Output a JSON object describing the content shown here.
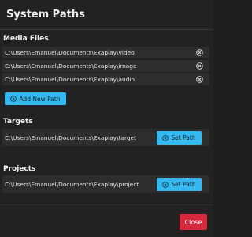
{
  "dialog": {
    "title": "System Paths"
  },
  "media_files": {
    "title": "Media Files",
    "paths": [
      "C:\\Users\\Emanuel\\Documents\\Exaplay\\video",
      "C:\\Users\\Emanuel\\Documents\\Exaplay\\image",
      "C:\\Users\\Emanuel\\Documents\\Exaplay\\audio"
    ],
    "add_button_label": "Add New Path"
  },
  "targets": {
    "title": "Targets",
    "path": "C:\\Users\\Emanuel\\Documents\\Exaplay\\target",
    "set_button_label": "Set Path"
  },
  "projects": {
    "title": "Projects",
    "path": "C:\\Users\\Emanuel\\Documents\\Exaplay\\project",
    "set_button_label": "Set Path"
  },
  "footer": {
    "close_label": "Close"
  },
  "colors": {
    "background": "#222222",
    "row_background": "#2d2d2d",
    "accent": "#33b8ef",
    "danger": "#d8283c"
  },
  "icons": {
    "remove": "circle-x-icon",
    "add": "plus-circle-icon",
    "set": "plus-circle-icon"
  }
}
